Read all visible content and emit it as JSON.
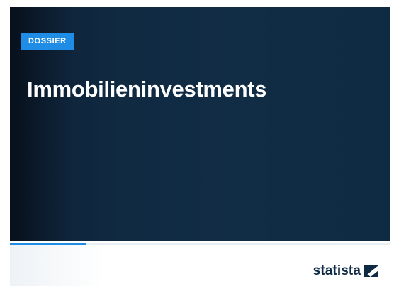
{
  "cover": {
    "badge": "DOSSIER",
    "title": "Immobilieninvestments"
  },
  "progress": {
    "fraction": 0.2
  },
  "brand": {
    "name": "statista",
    "icon": "statista-logo-icon"
  },
  "colors": {
    "cover_background": "#112c45",
    "accent": "#1f8ce6",
    "brand_text": "#0f2a43"
  }
}
